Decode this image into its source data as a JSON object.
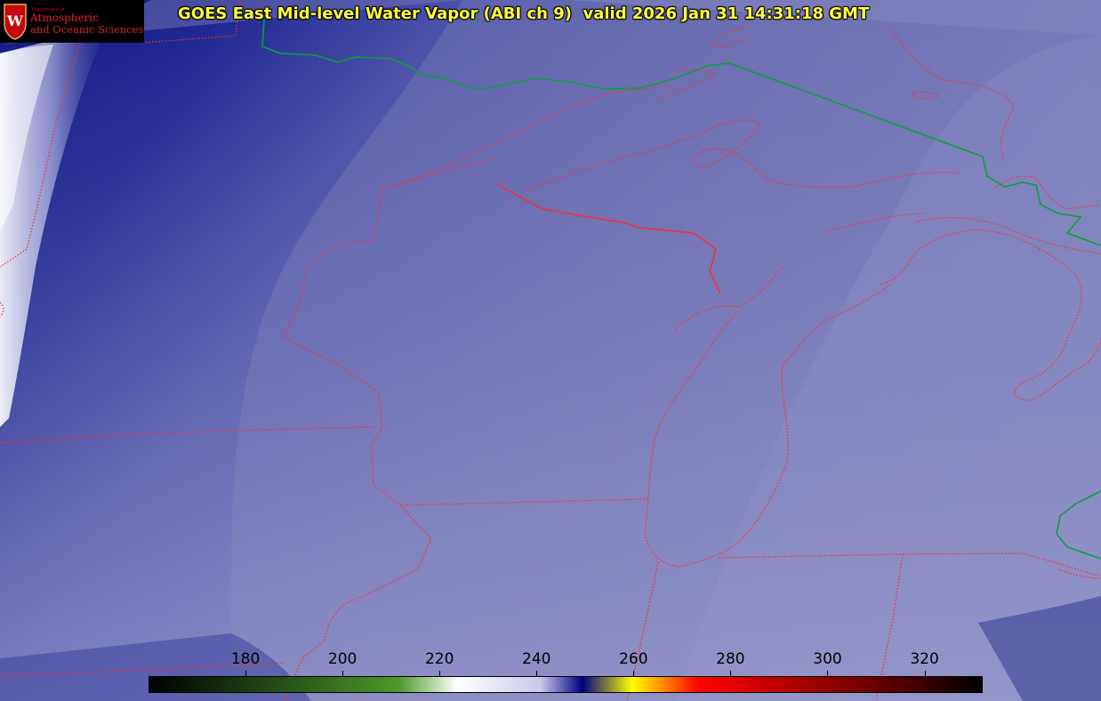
{
  "title": "GOES East Mid-level Water Vapor (ABI ch 9)  valid 2026 Jan 31 14:31:18 GMT",
  "logo": {
    "dept": "Department of",
    "line1": "Atmospheric",
    "line2": "and Oceanic Sciences",
    "seal_letter": "W"
  },
  "colorbar": {
    "units_min": 160,
    "units_max": 332,
    "ticks": [
      "180",
      "200",
      "220",
      "240",
      "260",
      "280",
      "300",
      "320"
    ],
    "tick_values": [
      180,
      200,
      220,
      240,
      260,
      280,
      300,
      320
    ],
    "colors": [
      "#000000",
      "#2a5a1c",
      "#4e9a2a",
      "#ffffff",
      "#c8c8ee",
      "#000080",
      "#ffff00",
      "#ff0000",
      "#7a0000",
      "#000000"
    ]
  },
  "map_colors": {
    "background": "#6f70b0",
    "dry_band": "#1a1f8a",
    "moist": "#ffffff",
    "state_borders": "#ff2020",
    "country_border": "#00aa00"
  }
}
